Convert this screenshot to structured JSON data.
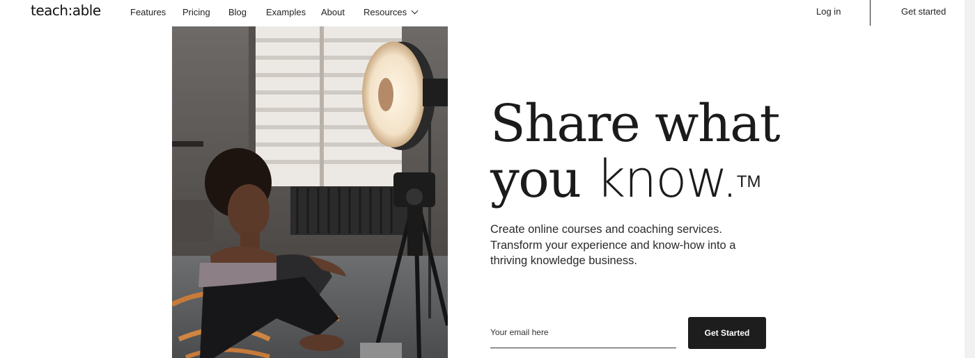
{
  "nav": {
    "logo": "teach:able",
    "links": [
      "Features",
      "Pricing",
      "Blog",
      "Examples",
      "About",
      "Resources"
    ],
    "login": "Log in",
    "get_started": "Get started"
  },
  "hero": {
    "headline_line1": "Share what",
    "headline_line2_a": "you ",
    "headline_line2_b": "know.",
    "trademark": "TM",
    "subtext": "Create online courses and coaching services. Transform your experience and know-how into a thriving knowledge business.",
    "email_placeholder": "Your email here",
    "cta_label": "Get Started"
  },
  "colors": {
    "text": "#1b1b1b",
    "button_bg": "#1d1d1d",
    "button_text": "#ffffff",
    "background": "#ffffff"
  },
  "icons": {
    "resources_menu": "chevron-down-icon"
  }
}
